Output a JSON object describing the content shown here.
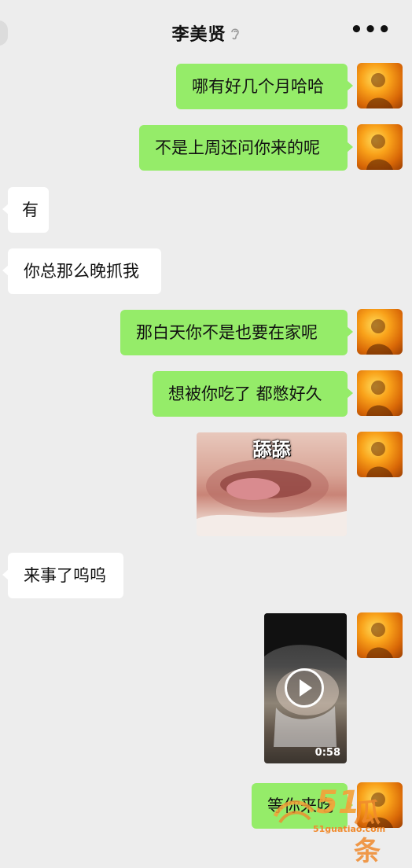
{
  "header": {
    "contact_name": "李美贤",
    "more_icon": "more-dots-icon",
    "mute_icon": "ear-icon"
  },
  "messages": [
    {
      "side": "me",
      "type": "text",
      "text": "哪有好几个月哈哈"
    },
    {
      "side": "me",
      "type": "text",
      "text": "不是上周还问你来的呢"
    },
    {
      "side": "them",
      "type": "text",
      "text": "有"
    },
    {
      "side": "them",
      "type": "text",
      "text": "你总那么晚抓我"
    },
    {
      "side": "me",
      "type": "text",
      "text": "那白天你不是也要在家呢"
    },
    {
      "side": "me",
      "type": "text",
      "text": "想被你吃了 都憋好久"
    },
    {
      "side": "me",
      "type": "sticker",
      "caption": "舔舔"
    },
    {
      "side": "them",
      "type": "text",
      "text": "来事了呜呜"
    },
    {
      "side": "me",
      "type": "video",
      "duration": "0:58"
    },
    {
      "side": "me",
      "type": "text",
      "text": "等你来吃"
    }
  ],
  "watermark": {
    "number": "51",
    "chinese": "瓜条",
    "url": "51guatiao.com"
  },
  "colors": {
    "background": "#ededed",
    "my_bubble": "#95ec69",
    "their_bubble": "#ffffff",
    "watermark": "#f08a2d"
  }
}
